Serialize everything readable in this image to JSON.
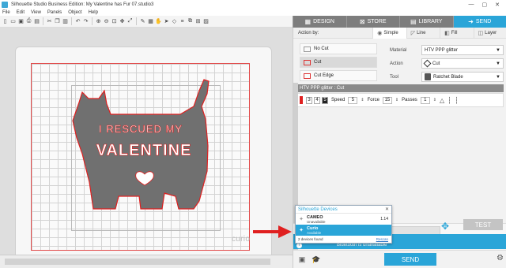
{
  "titlebar": {
    "title": "Silhouette Studio Business Edition: My Valentine has Fur 07.studio3",
    "controls": [
      "—",
      "▢",
      "✕"
    ]
  },
  "menu": [
    "File",
    "Edit",
    "View",
    "Panels",
    "Object",
    "Help"
  ],
  "nav_tabs": [
    {
      "label": "DESIGN",
      "icon": "grid-icon",
      "active": false
    },
    {
      "label": "STORE",
      "icon": "cart-icon",
      "active": false
    },
    {
      "label": "LIBRARY",
      "icon": "library-icon",
      "active": false
    },
    {
      "label": "SEND",
      "icon": "send-icon",
      "active": true
    }
  ],
  "canvas": {
    "brand": "curio",
    "design_text_line1": "I RESCUED MY",
    "design_text_line2": "VALENTINE"
  },
  "action_by": {
    "label": "Action by:",
    "modes": [
      {
        "label": "Simple",
        "active": true
      },
      {
        "label": "Line",
        "active": false
      },
      {
        "label": "Fill",
        "active": false
      },
      {
        "label": "Layer",
        "active": false
      }
    ]
  },
  "cut_options": [
    "No Cut",
    "Cut",
    "Cut Edge"
  ],
  "settings": {
    "material_label": "Material",
    "material_value": "HTV PPP glitter",
    "action_label": "Action",
    "action_value": "Cut",
    "tool_label": "Tool",
    "tool_value": "Ratchet Blade"
  },
  "mat_header": "HTV PPP glitter : Cut",
  "params": {
    "blade_digits": [
      "3",
      "4",
      "5"
    ],
    "speed_label": "Speed",
    "speed_value": "5",
    "force_label": "Force",
    "force_value": "15",
    "passes_label": "Passes",
    "passes_value": "1"
  },
  "devices_popup": {
    "title": "Silhouette Devices",
    "devices": [
      {
        "name": "CAMEO",
        "status": "Unavailable",
        "version": "1.14"
      },
      {
        "name": "Curio",
        "status": "Available",
        "version": ""
      }
    ],
    "found_text": "2 devices found",
    "rescan": "Rescan"
  },
  "status_message": "Bluetooth is unavailable",
  "test_button": "TEST",
  "send_button": "SEND",
  "colors": {
    "accent": "#2aa5d8",
    "cut_red": "#e02020",
    "shape_gray": "#707070"
  }
}
